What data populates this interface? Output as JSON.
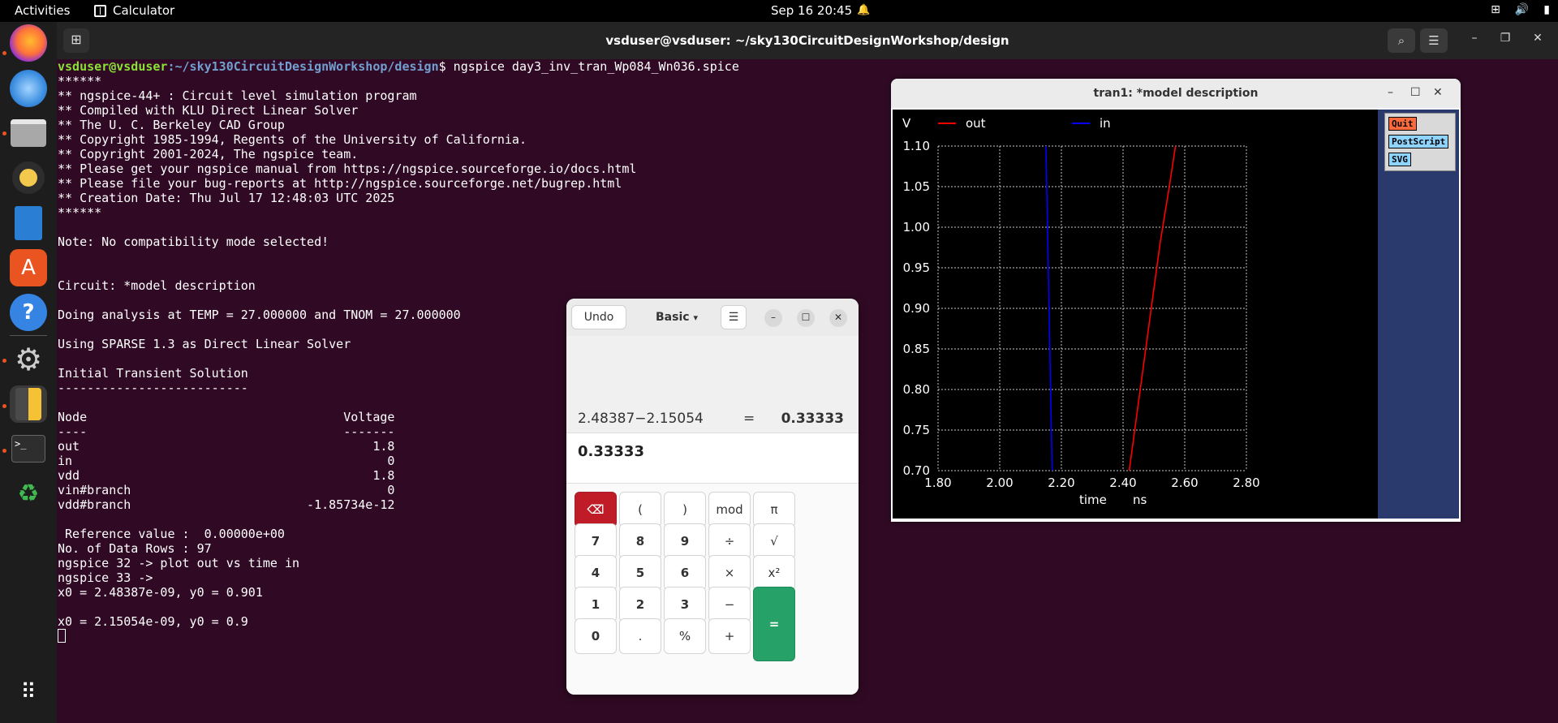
{
  "topbar": {
    "activities": "Activities",
    "app_name": "Calculator",
    "clock": "Sep 16  20:45"
  },
  "dock": {
    "items": [
      "firefox-icon",
      "thunderbird-icon",
      "files-icon",
      "rhythmbox-icon",
      "writer-icon",
      "app-center-icon",
      "help-icon",
      "settings-icon",
      "calculator-icon",
      "terminal-icon",
      "trash-icon",
      "show-apps-icon"
    ]
  },
  "terminal": {
    "title": "vsduser@vsduser: ~/sky130CircuitDesignWorkshop/design",
    "prompt_user": "vsduser@vsduser",
    "prompt_path": ":~/sky130CircuitDesignWorkshop/design",
    "prompt_cmd": "$ ngspice day3_inv_tran_Wp084_Wn036.spice",
    "lines": [
      "******",
      "** ngspice-44+ : Circuit level simulation program",
      "** Compiled with KLU Direct Linear Solver",
      "** The U. C. Berkeley CAD Group",
      "** Copyright 1985-1994, Regents of the University of California.",
      "** Copyright 2001-2024, The ngspice team.",
      "** Please get your ngspice manual from https://ngspice.sourceforge.io/docs.html",
      "** Please file your bug-reports at http://ngspice.sourceforge.net/bugrep.html",
      "** Creation Date: Thu Jul 17 12:48:03 UTC 2025",
      "******",
      "",
      "Note: No compatibility mode selected!",
      "",
      "",
      "Circuit: *model description",
      "",
      "Doing analysis at TEMP = 27.000000 and TNOM = 27.000000",
      "",
      "Using SPARSE 1.3 as Direct Linear Solver",
      "",
      "Initial Transient Solution",
      "--------------------------",
      "",
      "Node                                   Voltage",
      "----                                   -------",
      "out                                        1.8",
      "in                                           0",
      "vdd                                        1.8",
      "vin#branch                                   0",
      "vdd#branch                        -1.85734e-12",
      "",
      " Reference value :  0.00000e+00",
      "No. of Data Rows : 97",
      "ngspice 32 -> plot out vs time in",
      "ngspice 33 -> ",
      "x0 = 2.48387e-09, y0 = 0.901",
      "",
      "x0 = 2.15054e-09, y0 = 0.9"
    ]
  },
  "plot": {
    "window_title": "tran1: *model description",
    "buttons": [
      "Quit",
      "PostScript",
      "SVG"
    ],
    "chart_data": {
      "type": "line",
      "ylabel": "V",
      "xlabel": "time",
      "xunit": "ns",
      "xlim": [
        1.8,
        2.8
      ],
      "ylim": [
        0.7,
        1.1
      ],
      "xticks": [
        "1.80",
        "2.00",
        "2.20",
        "2.40",
        "2.60",
        "2.80"
      ],
      "yticks": [
        "1.10",
        "1.05",
        "1.00",
        "0.95",
        "0.90",
        "0.85",
        "0.80",
        "0.75",
        "0.70"
      ],
      "series": [
        {
          "name": "out",
          "color": "#ff0000",
          "x": [
            2.42,
            2.47,
            2.52,
            2.55,
            2.57
          ],
          "y": [
            0.7,
            0.84,
            0.98,
            1.05,
            1.1
          ]
        },
        {
          "name": "in",
          "color": "#0000ff",
          "x": [
            2.15,
            2.155,
            2.16,
            2.165,
            2.17
          ],
          "y": [
            1.1,
            1.0,
            0.9,
            0.8,
            0.7
          ]
        }
      ]
    }
  },
  "calculator": {
    "undo": "Undo",
    "mode": "Basic",
    "history_expr": "2.48387−2.15054",
    "history_eq": "=",
    "history_result": "0.33333",
    "entry": "0.33333",
    "keys": [
      [
        "⌫",
        "(",
        ")",
        "mod",
        "π"
      ],
      [
        "7",
        "8",
        "9",
        "÷",
        "√"
      ],
      [
        "4",
        "5",
        "6",
        "×",
        "x²"
      ],
      [
        "1",
        "2",
        "3",
        "−",
        "="
      ],
      [
        "0",
        ".",
        "%",
        "+"
      ]
    ]
  }
}
